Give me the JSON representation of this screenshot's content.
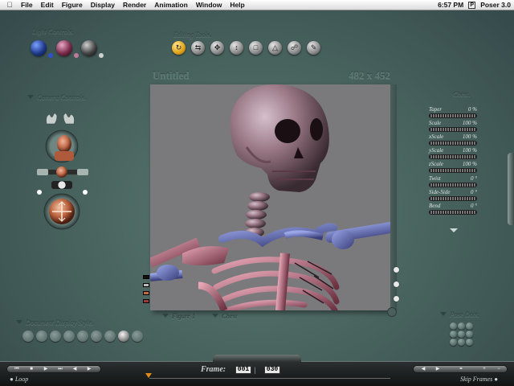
{
  "menubar": {
    "apple": "",
    "menus": [
      "File",
      "Edit",
      "Figure",
      "Display",
      "Render",
      "Animation",
      "Window",
      "Help"
    ],
    "clock": "6:57 PM",
    "app_name": "Poser 3.0"
  },
  "light_controls": {
    "label": "Light Controls."
  },
  "editing_tools": {
    "label": "Editing Tools."
  },
  "camera_controls": {
    "label": "Camera Controls."
  },
  "document": {
    "title": "Untitled",
    "size": "482 x 452",
    "figure_menu": "Figure 1",
    "part_menu": "Chest"
  },
  "parameters": {
    "label": "Chest.",
    "dials": [
      {
        "name": "Taper",
        "value": "0 %"
      },
      {
        "name": "Scale",
        "value": "100 %"
      },
      {
        "name": "xScale",
        "value": "100 %"
      },
      {
        "name": "yScale",
        "value": "100 %"
      },
      {
        "name": "zScale",
        "value": "100 %"
      },
      {
        "name": "Twist",
        "value": "0 °"
      },
      {
        "name": "Side-Side",
        "value": "0 °"
      },
      {
        "name": "Bend",
        "value": "0 °"
      }
    ]
  },
  "display_style": {
    "label": "Document Display Style."
  },
  "pose_dots": {
    "label": "Pose Dots."
  },
  "animation": {
    "frame_label": "Frame:",
    "current_frame": "001",
    "total_frames": "030",
    "loop_label": "Loop",
    "skip_frames_label": "Skip Frames"
  },
  "colors": {
    "background": "#4a6560",
    "active_tool": "#e0a21a",
    "canvas_bg": "#7a7a7c"
  }
}
